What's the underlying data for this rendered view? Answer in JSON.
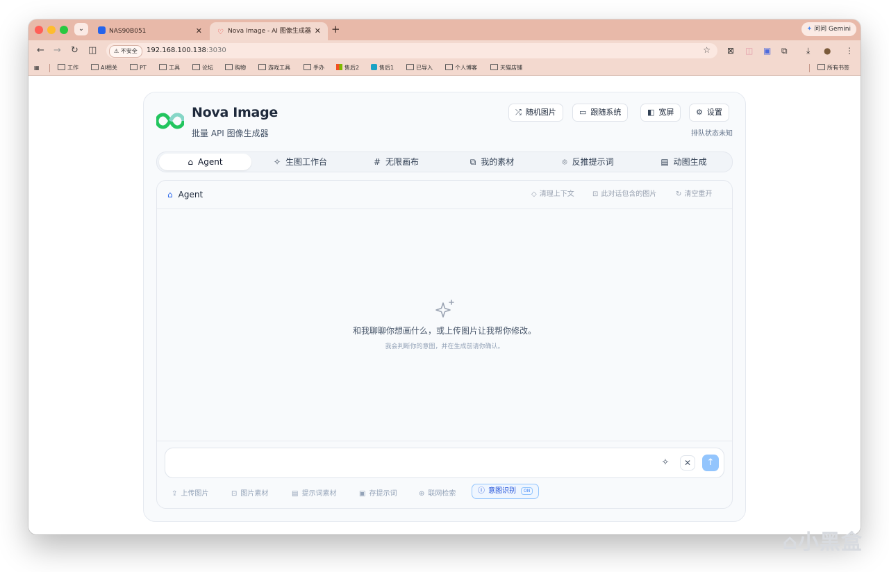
{
  "browser": {
    "tabs": [
      {
        "title": "NAS90B051"
      },
      {
        "title": "Nova Image - AI 图像生成器",
        "active": true
      }
    ],
    "gemini_label": "问问 Gemini",
    "security_label": "不安全",
    "url_host": "192.168.100.138",
    "url_port": ":3030",
    "bookmarks": [
      "工作",
      "AI相关",
      "PT",
      "工具",
      "论坛",
      "购物",
      "游戏工具",
      "手办",
      "售后2",
      "售后1",
      "已导入",
      "个人博客",
      "天猫店铺"
    ],
    "all_bookmarks": "所有书签"
  },
  "app": {
    "title": "Nova Image",
    "subtitle": "批量 API 图像生成器",
    "header_buttons": {
      "random": "随机图片",
      "theme": "跟随系统",
      "wide": "宽屏",
      "settings": "设置"
    },
    "queue_status": "排队状态未知",
    "colors": {
      "accent": "#2563eb",
      "send_button": "#93c5fd",
      "logo_green": "#22c55e"
    }
  },
  "tabs": [
    {
      "label": "Agent",
      "icon": "robot-icon",
      "active": true
    },
    {
      "label": "生图工作台",
      "icon": "sparkles-icon"
    },
    {
      "label": "无限画布",
      "icon": "hash-icon"
    },
    {
      "label": "我的素材",
      "icon": "gallery-icon"
    },
    {
      "label": "反推提示词",
      "icon": "scan-icon"
    },
    {
      "label": "动图生成",
      "icon": "film-icon"
    }
  ],
  "agent_panel": {
    "title": "Agent",
    "actions": {
      "clear_context": "清理上下文",
      "images_in_chat": "此对话包含的图片",
      "reset": "清空重开"
    },
    "empty_main": "和我聊聊你想画什么，或上传图片让我帮你修改。",
    "empty_sub": "我会判断你的意图，并在生成前请你确认。"
  },
  "composer": {
    "placeholder": "",
    "tools": {
      "upload": "上传图片",
      "assets": "图片素材",
      "prompt_assets": "提示词素材",
      "save_prompt": "存提示词",
      "web_search": "联网检索",
      "intent": "意图识别",
      "intent_state": "ON"
    }
  }
}
